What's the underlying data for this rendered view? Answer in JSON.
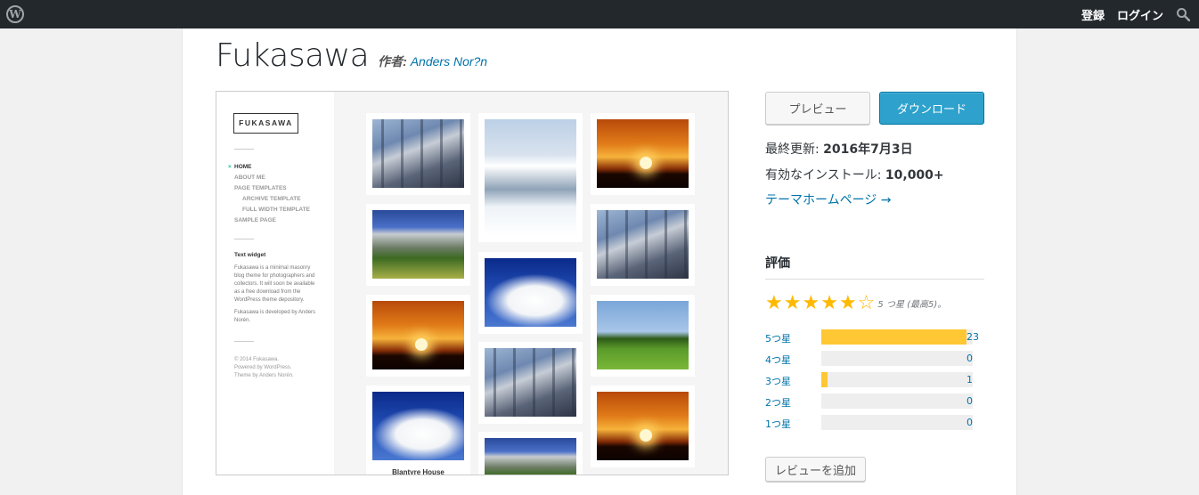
{
  "adminbar": {
    "logo_icon": "wordpress-logo-icon",
    "register_label": "登録",
    "login_label": "ログイン",
    "search_icon": "search-icon"
  },
  "theme": {
    "name": "Fukasawa",
    "author_prefix": "作者:",
    "author_name": "Anders Nor?n"
  },
  "preview": {
    "logo_text": "FUKASAWA",
    "menu": [
      {
        "label": "HOME",
        "current": true
      },
      {
        "label": "ABOUT ME"
      },
      {
        "label": "PAGE TEMPLATES"
      },
      {
        "label": "ARCHIVE TEMPLATE",
        "sub": true
      },
      {
        "label": "FULL WIDTH TEMPLATE",
        "sub": true
      },
      {
        "label": "SAMPLE PAGE"
      }
    ],
    "widget_title": "Text widget",
    "widget_p1": "Fukasawa is a minimal masonry blog theme for photographers and collectors. It will soon be available as a free download from the WordPress theme depository.",
    "widget_p2": "Fukasawa is developed by Anders Norén.",
    "footer_lines": [
      "© 2014 Fukasawa.",
      "Powered by WordPress.",
      "Theme by Anders Norén."
    ],
    "post_caption": "Blantyre House"
  },
  "actions": {
    "preview_label": "プレビュー",
    "download_label": "ダウンロード"
  },
  "meta": {
    "updated_label": "最終更新:",
    "updated_value": "2016年7月3日",
    "installs_label": "有効なインストール:",
    "installs_value": "10,000+",
    "homepage_link": "テーマホームページ →"
  },
  "ratings": {
    "heading": "評価",
    "stars_value": 5,
    "stars_label": "5 つ星 (最高5)。",
    "rows": [
      {
        "label": "5つ星",
        "count": "23",
        "fraction": 0.96
      },
      {
        "label": "4つ星",
        "count": "0",
        "fraction": 0
      },
      {
        "label": "3つ星",
        "count": "1",
        "fraction": 0.04
      },
      {
        "label": "2つ星",
        "count": "0",
        "fraction": 0
      },
      {
        "label": "1つ星",
        "count": "0",
        "fraction": 0
      }
    ],
    "add_review_label": "レビューを追加"
  },
  "colors": {
    "adminbar_bg": "#23282d",
    "download_button": "#2ea2cc",
    "link": "#0073aa",
    "star": "#ffb900",
    "rating_fill": "#ffc733"
  }
}
